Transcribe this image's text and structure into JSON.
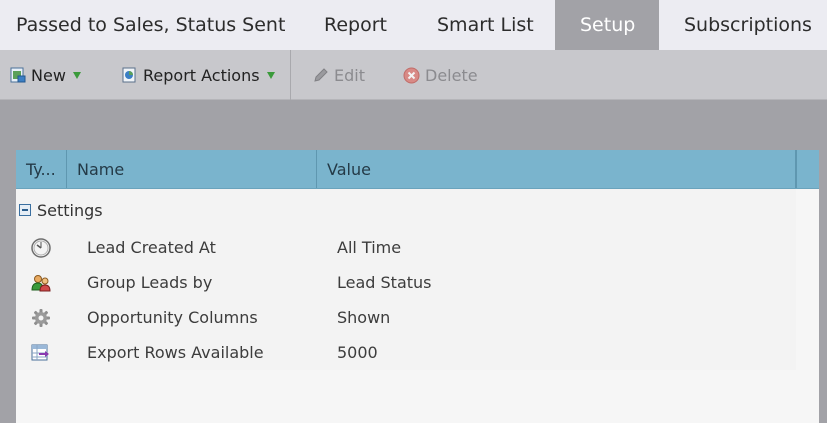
{
  "tabs": [
    {
      "label": "Passed to Sales, Status Sent",
      "active": false
    },
    {
      "label": "Report",
      "active": false
    },
    {
      "label": "Smart List",
      "active": false
    },
    {
      "label": "Setup",
      "active": true
    },
    {
      "label": "Subscriptions",
      "active": false
    }
  ],
  "toolbar": {
    "new_label": "New",
    "report_actions_label": "Report Actions",
    "edit_label": "Edit",
    "delete_label": "Delete"
  },
  "grid": {
    "columns": [
      "Ty...",
      "Name",
      "Value"
    ],
    "group_label": "Settings",
    "rows": [
      {
        "icon": "clock-icon",
        "name": "Lead Created At",
        "value": "All Time"
      },
      {
        "icon": "group-people-icon",
        "name": "Group Leads by",
        "value": "Lead Status"
      },
      {
        "icon": "gear-icon",
        "name": "Opportunity Columns",
        "value": "Shown"
      },
      {
        "icon": "export-table-icon",
        "name": "Export Rows Available",
        "value": "5000"
      }
    ]
  },
  "colors": {
    "header_blue": "#7ab4cd",
    "active_tab": "#a2a2a7",
    "caret_green": "#3a9a3a",
    "delete_red": "#d9534f"
  }
}
